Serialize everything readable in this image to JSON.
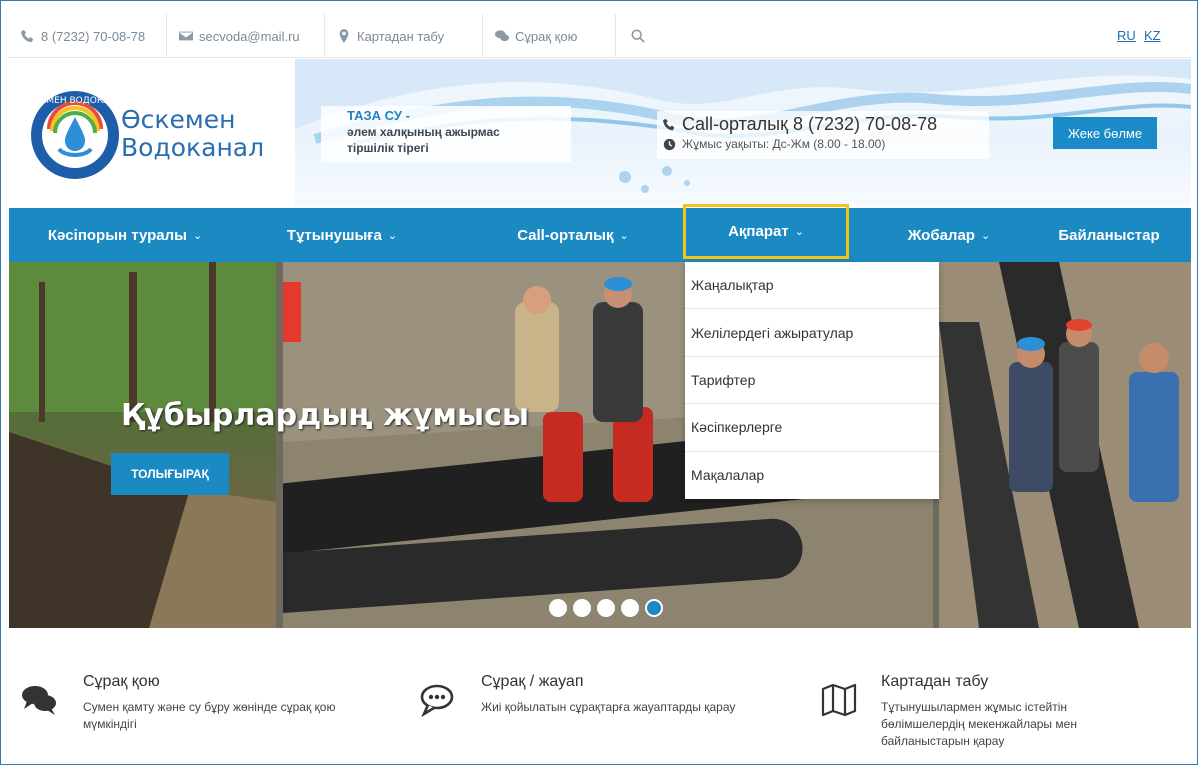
{
  "topbar": {
    "phone": "8 (7232) 70-08-78",
    "email": "secvoda@mail.ru",
    "map": "Картадан табу",
    "ask": "Сұрақ қою",
    "lang_ru": "RU",
    "lang_kz": "KZ",
    "icons": [
      "phone-icon",
      "envelope-icon",
      "map-pin-icon",
      "chat-icon",
      "search-icon"
    ]
  },
  "header": {
    "logo_line1": "Өскемен",
    "logo_line2": "Водоканал",
    "logo_ring_text": "ӨСКЕМЕН ВОДОКАНАЛ",
    "slogan_line1": "ТАЗА СУ -",
    "slogan_line2": "әлем халқының ажырмас",
    "slogan_line3": "тіршілік тірегі",
    "call_center": "Call-орталық 8 (7232) 70-08-78",
    "work_hours": "Жұмыс уақыты: Дс-Жм (8.00 - 18.00)",
    "cabinet_button": "Жеке бөлме"
  },
  "nav": {
    "items": [
      {
        "label": "Кәсіпорын туралы",
        "chevron": "⌄"
      },
      {
        "label": "Тұтынушыға",
        "chevron": "⌄"
      },
      {
        "label": "Call-орталық",
        "chevron": "⌄"
      },
      {
        "label": "Ақпарат",
        "chevron": "⌄"
      },
      {
        "label": "Жобалар",
        "chevron": "⌄"
      },
      {
        "label": "Байланыстар",
        "chevron": ""
      }
    ]
  },
  "dropdown": {
    "items": [
      "Жаңалықтар",
      "Желілердегі ажыратулар",
      "Тарифтер",
      "Кәсіпкерлерге",
      "Мақалалар"
    ]
  },
  "hero": {
    "title": "Құбырлардың жұмысы",
    "button": "ТОЛЫҒЫРАҚ",
    "slides_total": 5,
    "active_slide": 5
  },
  "features": [
    {
      "icon": "chat-bubbles-icon",
      "title": "Сұрақ қою",
      "desc": "Сумен қамту және су бұру жөнінде сұрақ қою мүмкіндігі"
    },
    {
      "icon": "speech-dots-icon",
      "title": "Сұрақ / жауап",
      "desc": "Жиі қойылатын сұрақтарға жауаптарды қарау"
    },
    {
      "icon": "folded-map-icon",
      "title": "Картадан табу",
      "desc": "Тұтынушылармен жұмыс істейтін бөлімшелердің мекенжайлары мен байланыстарын қарау"
    }
  ],
  "colors": {
    "brand_blue": "#1b8ac3",
    "highlight": "#f0c419",
    "link": "#1f6db3"
  }
}
